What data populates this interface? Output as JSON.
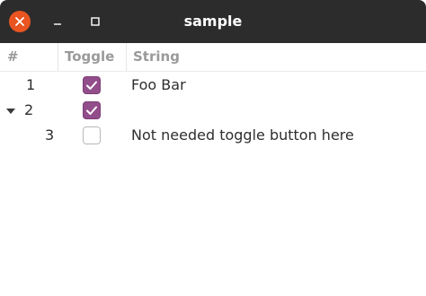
{
  "window": {
    "title": "sample"
  },
  "columns": {
    "index": "#",
    "toggle": "Toggle",
    "string": "String"
  },
  "rows": [
    {
      "index": "1",
      "toggle": true,
      "string": "Foo Bar",
      "expander": false
    },
    {
      "index": "2",
      "toggle": true,
      "string": "",
      "expander": true,
      "expanded": true
    },
    {
      "index": "3",
      "toggle": false,
      "string": "Not needed toggle button here",
      "expander": false
    }
  ],
  "colors": {
    "titlebar": "#2c2c2c",
    "close_button": "#e95420",
    "checkbox_checked": "#924d8b"
  }
}
